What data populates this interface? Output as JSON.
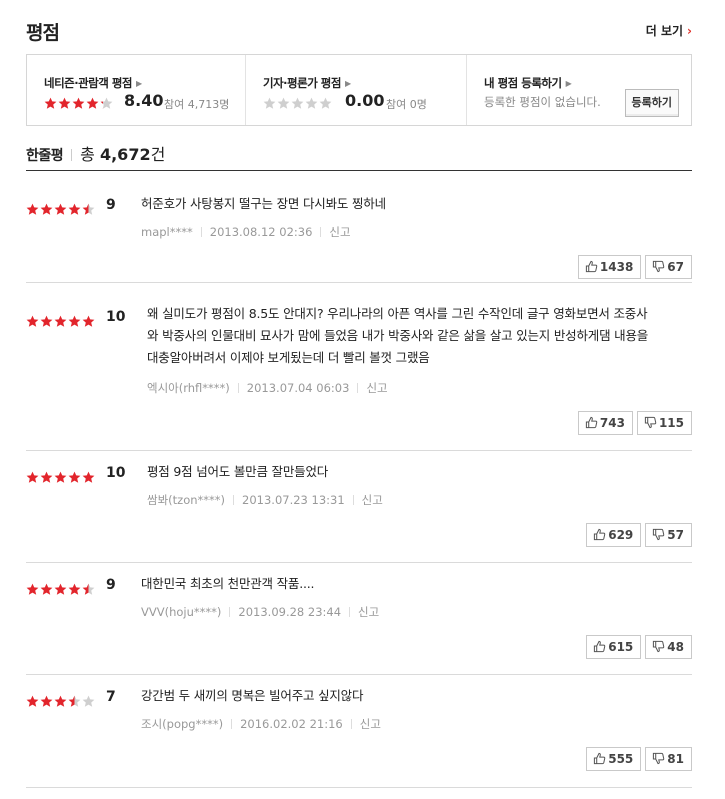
{
  "header": {
    "title": "평점",
    "more_label": "더 보기"
  },
  "summary": {
    "netizen": {
      "title": "네티즌·관람객 평점",
      "score": "8.40",
      "count": "참여 4,713명",
      "stars": 4.2
    },
    "critic": {
      "title": "기자·평론가 평점",
      "score": "0.00",
      "count": "참여 0명",
      "stars": 0
    },
    "mine": {
      "title": "내 평점 등록하기",
      "empty": "등록한 평점이 없습니다.",
      "button": "등록하기"
    }
  },
  "oneline": {
    "label": "한줄평",
    "total_label": "총",
    "total": "4,672",
    "unit": "건"
  },
  "colors": {
    "star_on": "#e2252c",
    "star_off": "#cfcfcf",
    "accent": "#e0332c"
  },
  "reviews": [
    {
      "stars": 4.5,
      "score": "9",
      "text": "허준호가 사탕봉지 떨구는 장면 다시봐도 찡하네",
      "user": "mapl****",
      "date": "2013.08.12 02:36",
      "report": "신고",
      "up": "1438",
      "down": "67"
    },
    {
      "stars": 5,
      "score": "10",
      "text": "왜 실미도가 평점이 8.5도 안대지? 우리나라의 아픈 역사를 그린 수작인데 글구 영화보면서 조중사와 박중사의 인물대비 묘사가 맘에 들었음 내가 박중사와 같은 삶을 살고 있는지 반성하게댐 내용을 대충알아버려서 이제야 보게됬는데 더 빨리 볼껏 그랬음",
      "user": "엑시아(rhfl****)",
      "date": "2013.07.04 06:03",
      "report": "신고",
      "up": "743",
      "down": "115"
    },
    {
      "stars": 5,
      "score": "10",
      "text": "평점 9점 넘어도 볼만큼 잘만들었다",
      "user": "쌈봐(tzon****)",
      "date": "2013.07.23 13:31",
      "report": "신고",
      "up": "629",
      "down": "57"
    },
    {
      "stars": 4.5,
      "score": "9",
      "text": "대한민국 최초의 천만관객 작품....",
      "user": "VVV(hoju****)",
      "date": "2013.09.28 23:44",
      "report": "신고",
      "up": "615",
      "down": "48"
    },
    {
      "stars": 3.5,
      "score": "7",
      "text": "강간범 두 새끼의 명복은 빌어주고 싶지않다",
      "user": "조시(popg****)",
      "date": "2016.02.02 21:16",
      "report": "신고",
      "up": "555",
      "down": "81"
    }
  ]
}
